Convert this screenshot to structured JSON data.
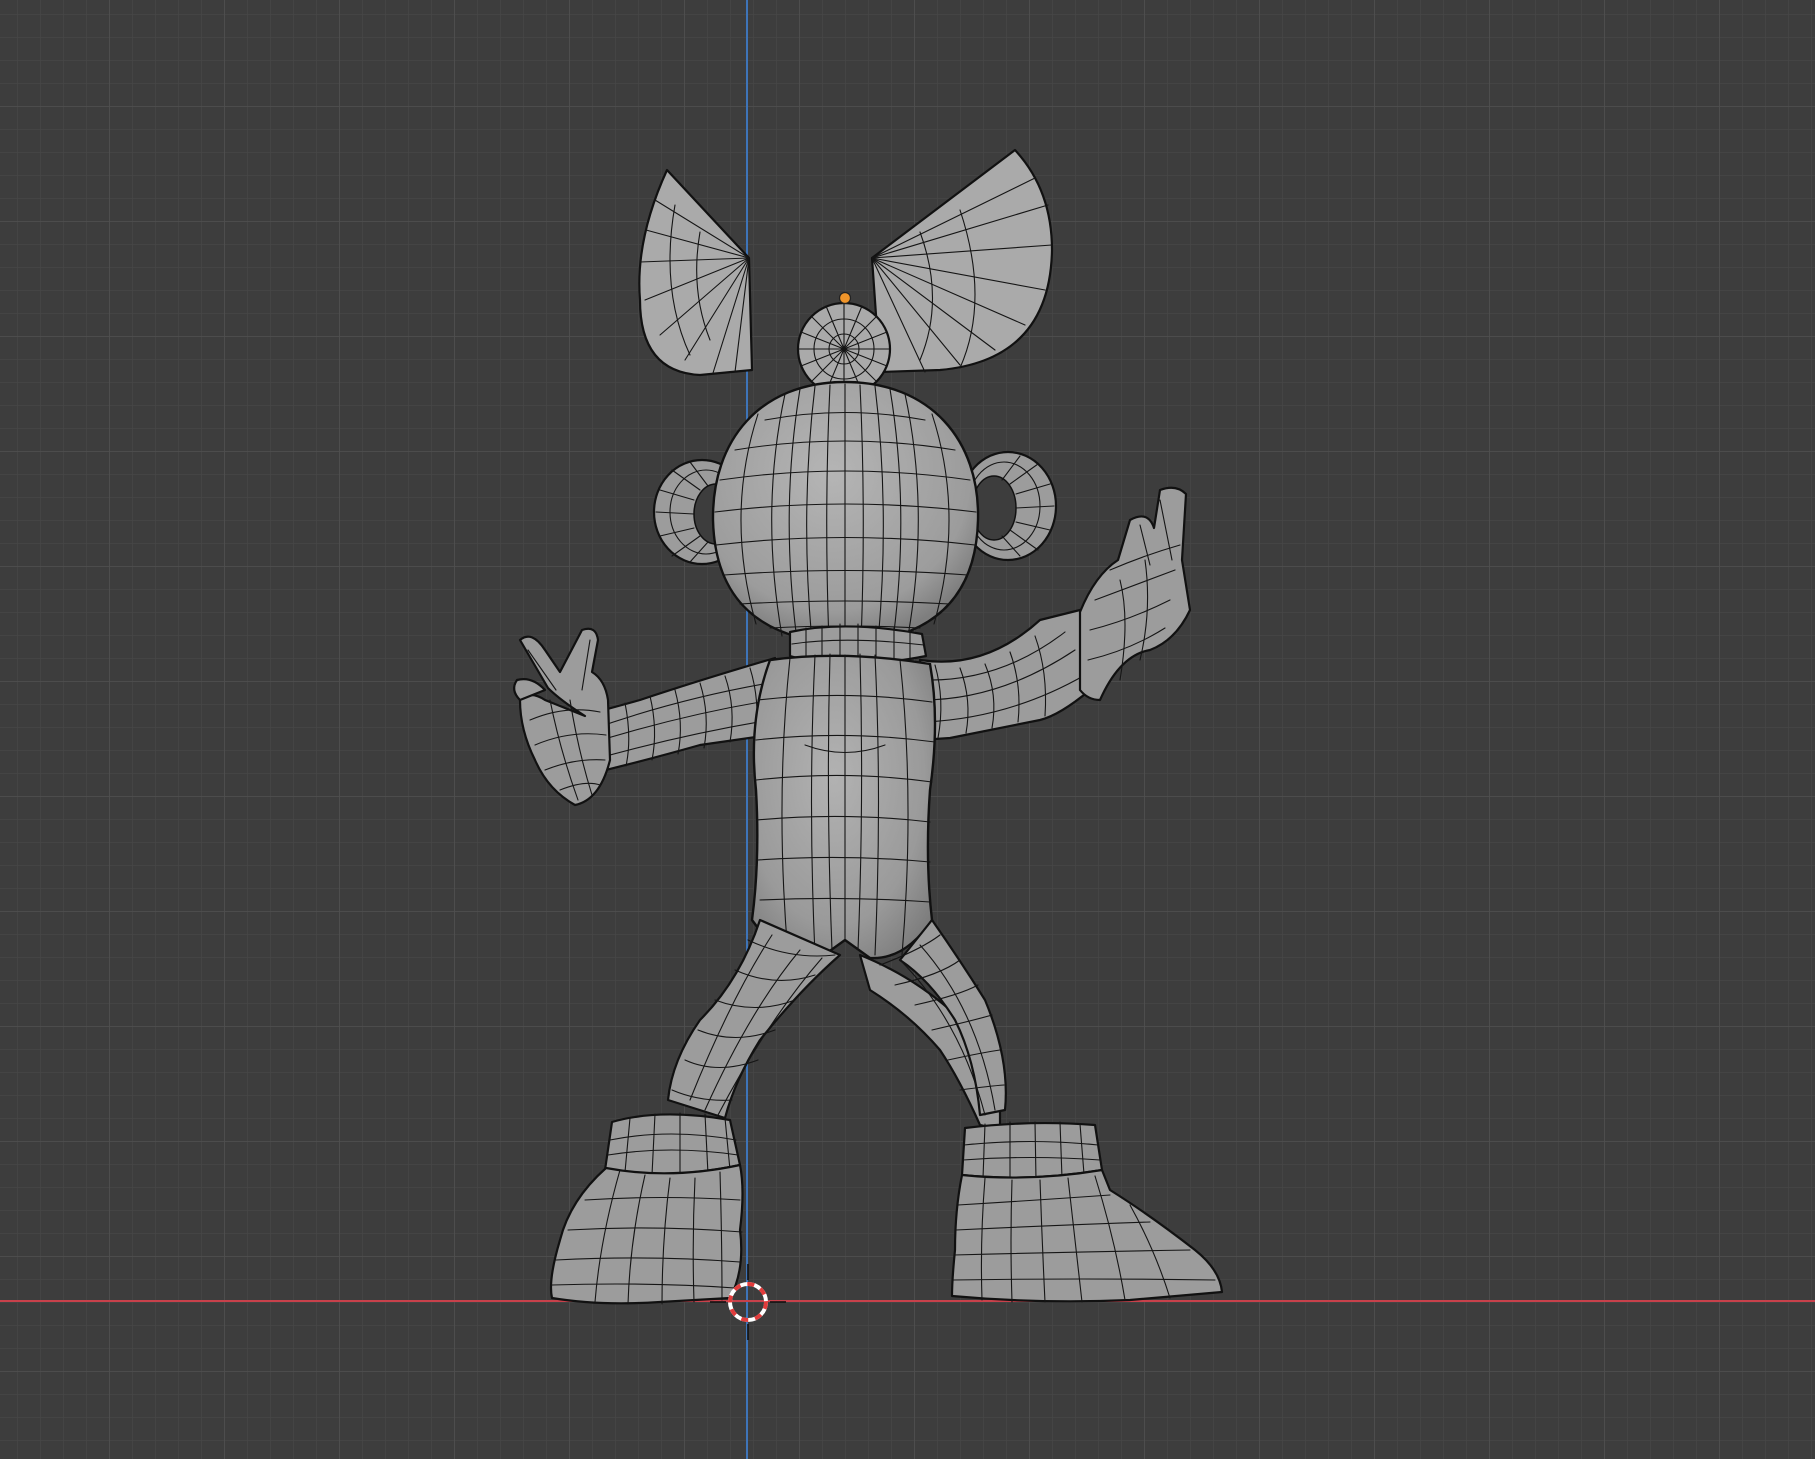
{
  "viewport": {
    "background_color": "#3d3d3d",
    "grid_minor_color": "#474747",
    "grid_major_color": "#4f4f4f",
    "x_axis_color": "#c8414b",
    "z_axis_color": "#3e74b8",
    "mesh_color": "#9c9c9c",
    "wire_color": "#151515",
    "origin_color": "#f0952a",
    "cursor_colors": [
      "#e23c3c",
      "#ffffff"
    ],
    "icons": [
      "3d-cursor-icon",
      "object-origin-icon"
    ]
  }
}
